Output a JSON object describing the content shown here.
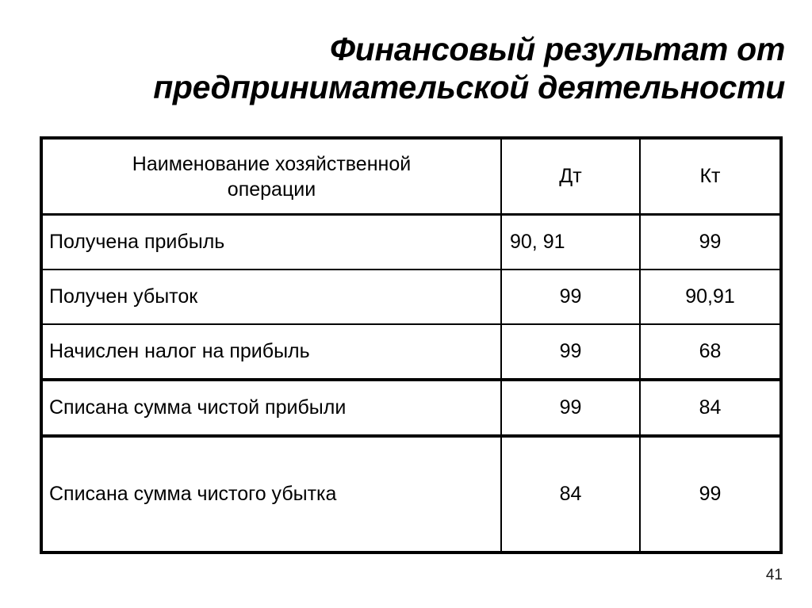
{
  "slide": {
    "title": "Финансовый результат от\nпредпринимательской деятельности",
    "page_number": "41"
  },
  "table": {
    "columns": [
      {
        "key": "operation",
        "header": "Наименование хозяйственной\nоперации"
      },
      {
        "key": "debit",
        "header": "Дт"
      },
      {
        "key": "credit",
        "header": "Кт"
      }
    ],
    "rows": [
      {
        "operation": "Получена прибыль",
        "debit": "90, 91",
        "credit": "99"
      },
      {
        "operation": "Получен убыток",
        "debit": "99",
        "credit": "90,91"
      },
      {
        "operation": "Начислен налог на прибыль",
        "debit": "99",
        "credit": "68"
      },
      {
        "operation": "Списана сумма чистой прибыли",
        "debit": "99",
        "credit": "84"
      },
      {
        "operation": "Списана сумма чистого убытка",
        "debit": "84",
        "credit": "99"
      }
    ]
  },
  "colors": {
    "text": "#000000",
    "border": "#000000",
    "background": "#ffffff"
  }
}
